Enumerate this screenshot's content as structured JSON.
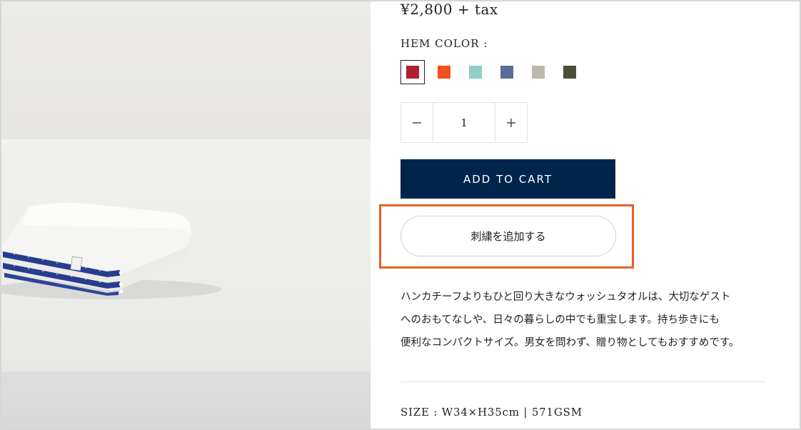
{
  "product": {
    "price": "¥2,800 + tax",
    "hem_color_label": "HEM COLOR :",
    "hem_colors": [
      {
        "name": "red",
        "hex": "#b21f32",
        "selected": true
      },
      {
        "name": "orange",
        "hex": "#f0501e",
        "selected": false
      },
      {
        "name": "mint",
        "hex": "#8fcfc8",
        "selected": false
      },
      {
        "name": "slate-blue",
        "hex": "#5a6b97",
        "selected": false
      },
      {
        "name": "light-gray",
        "hex": "#bbb8af",
        "selected": false
      },
      {
        "name": "olive",
        "hex": "#4b4f35",
        "selected": false
      }
    ],
    "quantity": "1",
    "add_to_cart_label": "ADD TO CART",
    "embroidery_label": "刺繍を追加する",
    "description": [
      "ハンカチーフよりもひと回り大きなウォッシュタオルは、大切なゲスト",
      "へのおもてなしや、日々の暮らしの中でも重宝します。持ち歩きにも",
      "便利なコンパクトサイズ。男女を問わず、贈り物としてもおすすめです。"
    ],
    "spec": "SIZE : W34×H35cm | 571GSM"
  },
  "colors": {
    "cart_button_bg": "#00254d",
    "highlight_border": "#e4622a"
  },
  "icons": {
    "minus": "minus-icon",
    "plus": "plus-icon"
  }
}
